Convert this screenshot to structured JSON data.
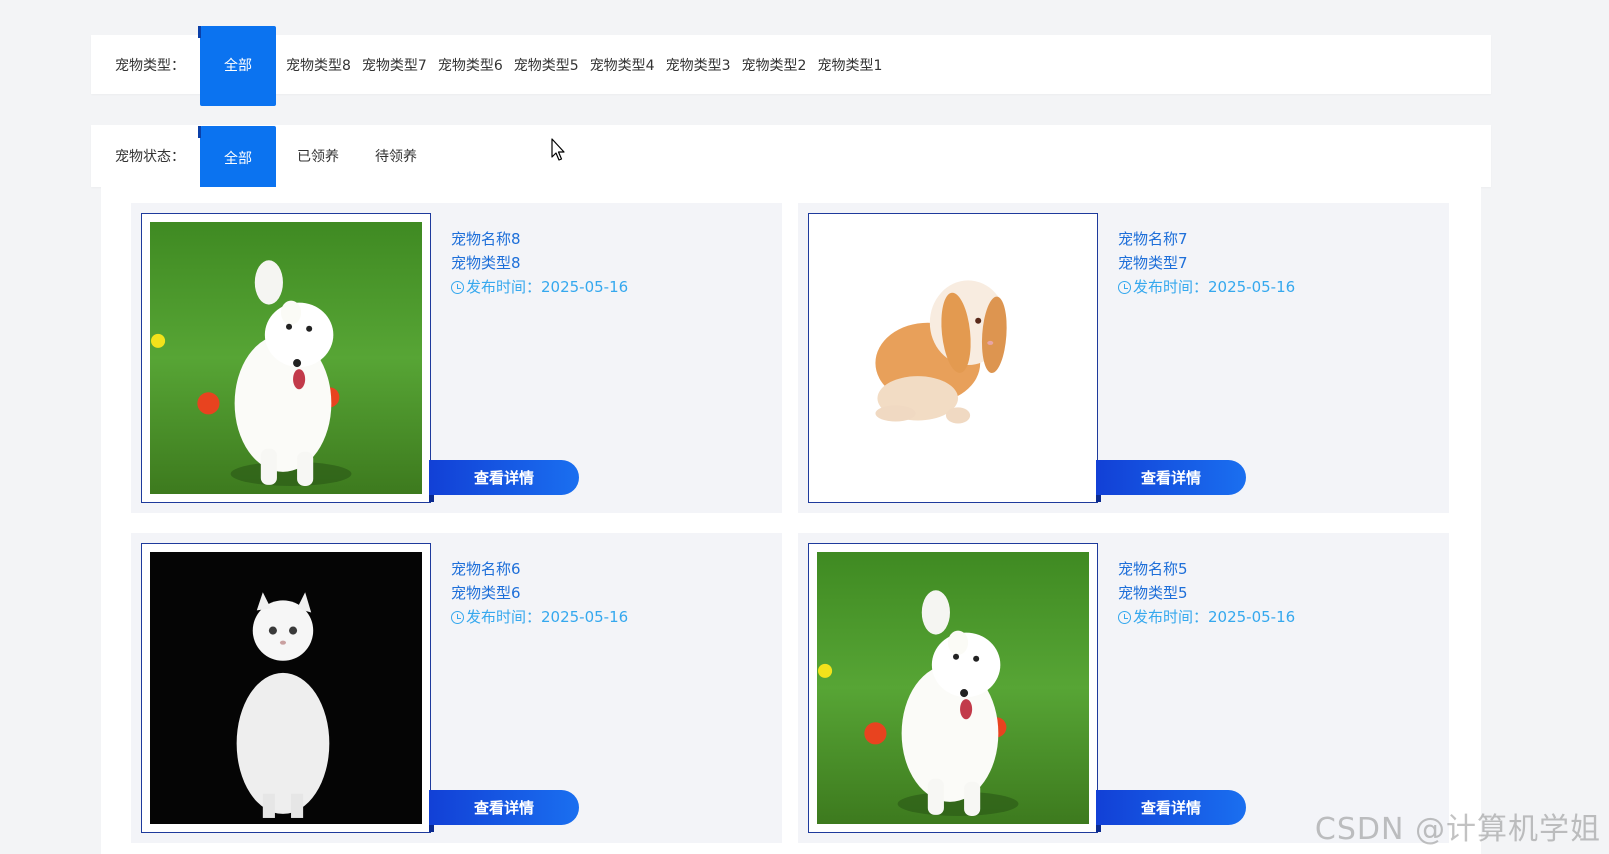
{
  "filters": {
    "type": {
      "label": "宠物类型：",
      "options": [
        "全部",
        "宠物类型8",
        "宠物类型7",
        "宠物类型6",
        "宠物类型5",
        "宠物类型4",
        "宠物类型3",
        "宠物类型2",
        "宠物类型1"
      ],
      "selected": "全部"
    },
    "status": {
      "label": "宠物状态：",
      "options": [
        "全部",
        "已领养",
        "待领养"
      ],
      "selected": "全部"
    }
  },
  "pets": [
    {
      "name": "宠物名称8",
      "type": "宠物类型8",
      "date": "发布时间：2025-05-16",
      "image": "white-puppy-on-grass",
      "button": "查看详情"
    },
    {
      "name": "宠物名称7",
      "type": "宠物类型7",
      "date": "发布时间：2025-05-16",
      "image": "lop-eared-rabbit",
      "button": "查看详情"
    },
    {
      "name": "宠物名称6",
      "type": "宠物类型6",
      "date": "发布时间：2025-05-16",
      "image": "white-persian-cat",
      "button": "查看详情"
    },
    {
      "name": "宠物名称5",
      "type": "宠物类型5",
      "date": "发布时间：2025-05-16",
      "image": "white-puppy-on-grass",
      "button": "查看详情"
    }
  ],
  "watermark": "CSDN @计算机学姐",
  "colors": {
    "accent": "#0b73f0",
    "link": "#1e6fd9",
    "date": "#35a8ee"
  }
}
